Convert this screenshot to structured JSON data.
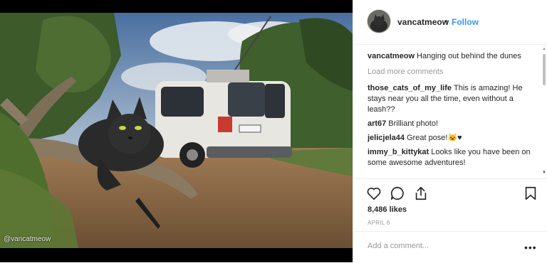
{
  "post": {
    "username": "vancatmeow",
    "follow_label": "Follow",
    "separator": "•",
    "watermark": "@vancatmeow"
  },
  "caption": {
    "username": "vancatmeow",
    "text": "Hanging out behind the dunes"
  },
  "load_more_label": "Load more comments",
  "comments": [
    {
      "username": "those_cats_of_my_life",
      "text": "This is amazing! He stays near you all the time, even without a leash??"
    },
    {
      "username": "art67",
      "text": "Brilliant photo!"
    },
    {
      "username": "jelicjela44",
      "text": "Great pose!😺♥"
    },
    {
      "username": "immy_b_kittykat",
      "text": "Looks like you have been on some awesome adventures!"
    }
  ],
  "actions": {
    "like_icon": "heart-icon",
    "comment_icon": "comment-icon",
    "share_icon": "share-icon",
    "save_icon": "bookmark-icon"
  },
  "likes_text": "8,486 likes",
  "date_text": "APRIL 6",
  "add_comment_placeholder": "Add a comment...",
  "more_label": "•••",
  "colors": {
    "follow": "#3897f0",
    "text": "#262626",
    "muted": "#999999",
    "border": "#efefef"
  }
}
